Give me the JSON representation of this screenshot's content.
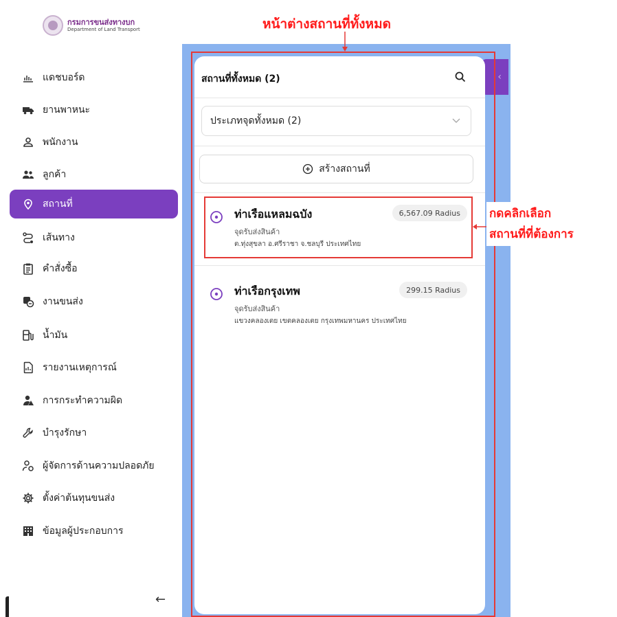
{
  "org": {
    "name_th": "กรมการขนส่งทางบก",
    "name_en": "Department of Land Transport"
  },
  "sidebar": {
    "items": [
      {
        "label": "แดชบอร์ด",
        "icon": "chart-icon"
      },
      {
        "label": "ยานพาหนะ",
        "icon": "truck-icon"
      },
      {
        "label": "พนักงาน",
        "icon": "user-icon"
      },
      {
        "label": "ลูกค้า",
        "icon": "users-icon"
      },
      {
        "label": "สถานที่",
        "icon": "location-pin-icon",
        "active": true
      },
      {
        "label": "เส้นทาง",
        "icon": "route-icon"
      },
      {
        "label": "คำสั่งซื้อ",
        "icon": "clipboard-icon"
      },
      {
        "label": "งานขนส่ง",
        "icon": "delivery-icon"
      },
      {
        "label": "น้ำมัน",
        "icon": "fuel-icon"
      },
      {
        "label": "รายงานเหตุการณ์",
        "icon": "report-icon"
      },
      {
        "label": "การกระทำความผิด",
        "icon": "violation-icon"
      },
      {
        "label": "บำรุงรักษา",
        "icon": "wrench-icon"
      },
      {
        "label": "ผู้จัดการด้านความปลอดภัย",
        "icon": "safety-manager-icon"
      },
      {
        "label": "ตั้งค่าต้นทุนขนส่ง",
        "icon": "gear-icon"
      },
      {
        "label": "ข้อมูลผู้ประกอบการ",
        "icon": "building-icon"
      }
    ],
    "collapse_glyph": "←"
  },
  "panel": {
    "title": "สถานที่ทั้งหมด (2)",
    "filter_value": "ประเภทจุดทั้งหมด (2)",
    "create_label": "สร้างสถานที่",
    "locations": [
      {
        "name": "ท่าเรือแหลมฉบัง",
        "type": "จุดรับส่งสินค้า",
        "address": "ต.ทุ่งสุขลา อ.ศรีราชา จ.ชลบุรี ประเทศไทย",
        "radius": "6,567.09 Radius"
      },
      {
        "name": "ท่าเรือกรุงเทพ",
        "type": "จุดรับส่งสินค้า",
        "address": "แขวงคลองเตย เขตคลองเตย กรุงเทพมหานคร ประเทศไทย",
        "radius": "299.15 Radius"
      }
    ]
  },
  "annotations": {
    "window_label": "หน้าต่างสถานที่ทั้งหมด",
    "click_line1": "กดคลิกเลือก",
    "click_line2": "สถานที่ที่ต้องการ"
  },
  "colors": {
    "accent": "#7b3fbf",
    "main_bg": "#8ab3ef",
    "annotation": "#ff1a1a"
  }
}
